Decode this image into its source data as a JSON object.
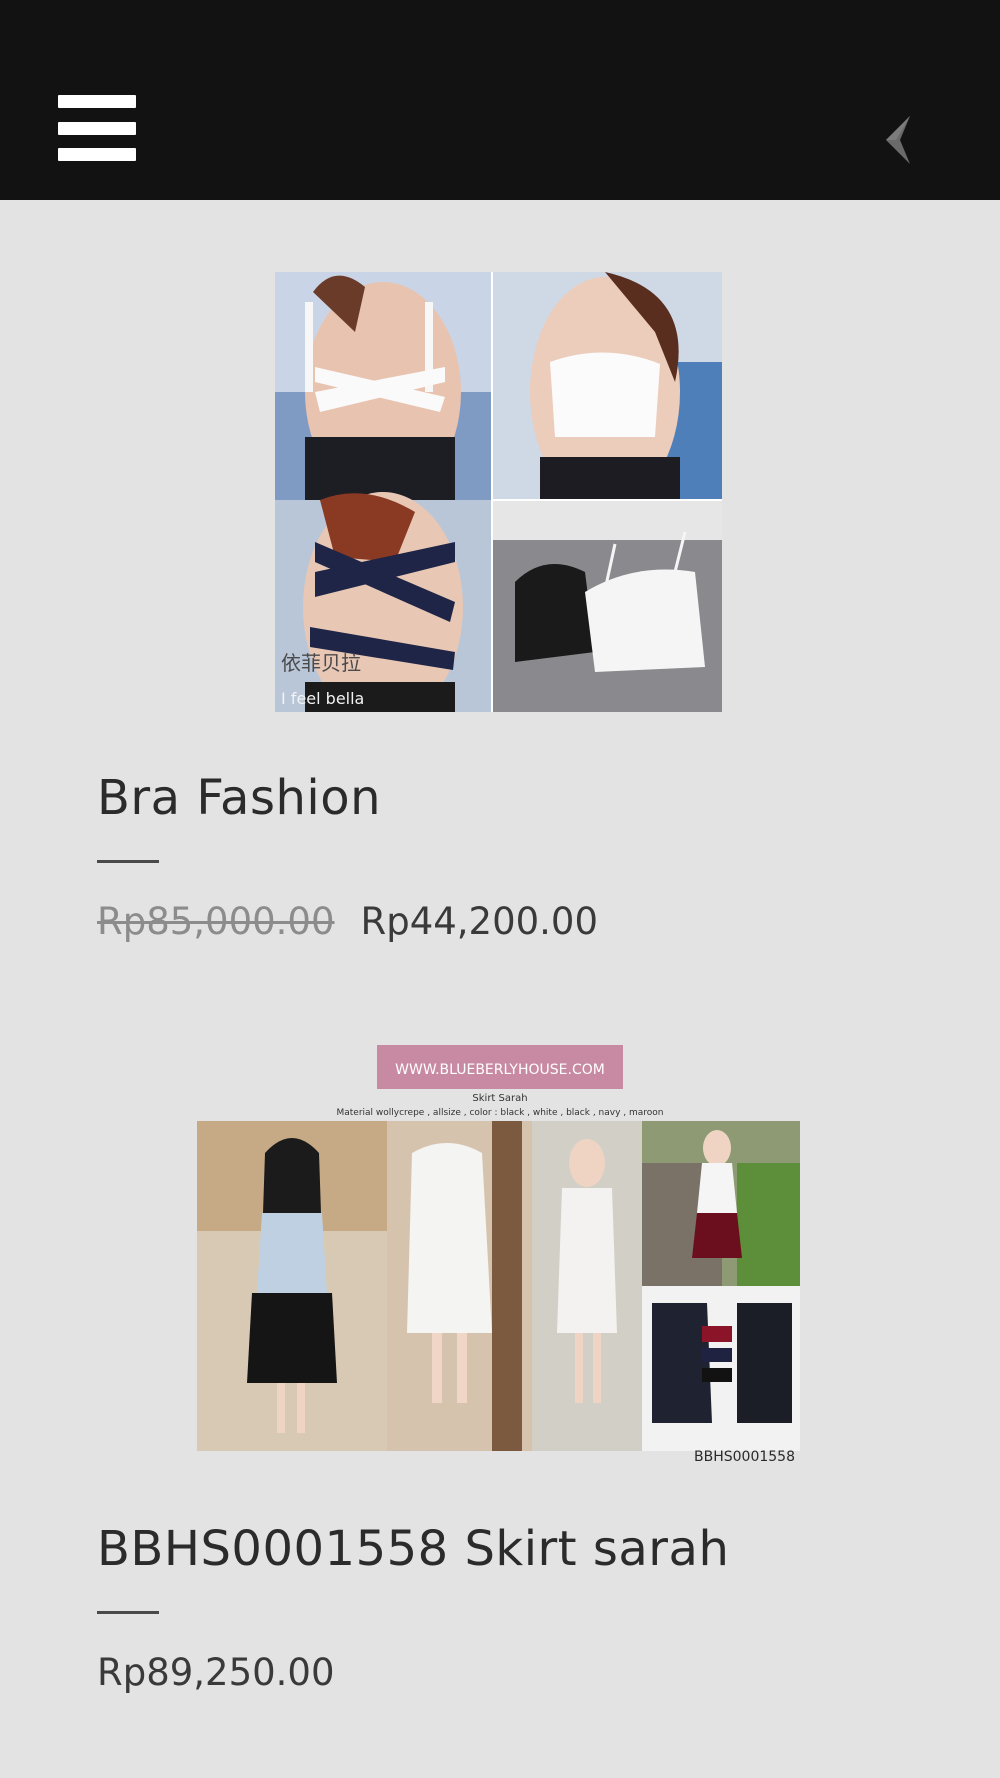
{
  "header": {
    "menu_icon": "hamburger-menu-icon",
    "back_icon": "chevron-left-icon",
    "background": "#121212"
  },
  "products": [
    {
      "title": "Bra Fashion",
      "original_price": "Rp85,000.00",
      "sale_price": "Rp44,200.00",
      "image_caption": "依菲贝拉\nI feel bella"
    },
    {
      "title": "BBHS0001558 Skirt sarah",
      "price": "Rp89,250.00",
      "image_banner": "WWW.BLUEBERLYHOUSE.COM",
      "image_subtitle": "Skirt Sarah",
      "image_details": "Material wollycrepe , allsize , color : black , white , black , navy , maroon",
      "image_code": "BBHS0001558",
      "swatch_labels": [
        "white",
        "navy",
        "black"
      ]
    }
  ]
}
